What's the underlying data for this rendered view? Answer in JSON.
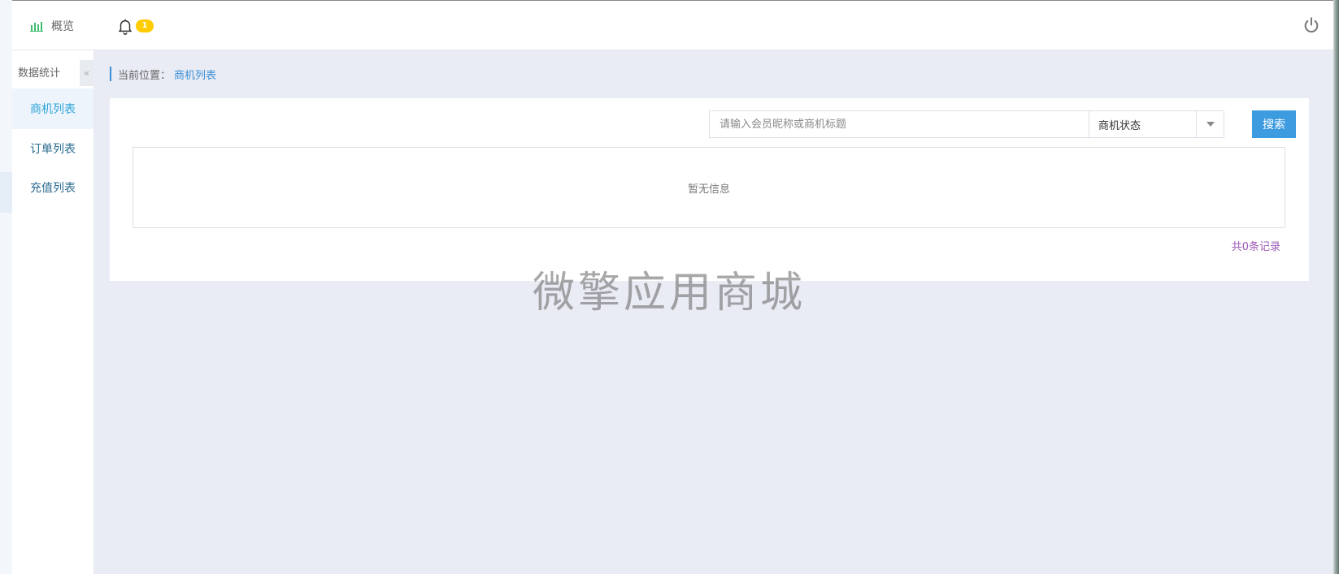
{
  "header": {
    "brand_label": "概览",
    "notification_count": "1"
  },
  "sidebar": {
    "title": "数据统计",
    "collapse_glyph": "«",
    "items": [
      {
        "label": "商机列表",
        "active": true
      },
      {
        "label": "订单列表",
        "active": false
      },
      {
        "label": "充值列表",
        "active": false
      }
    ]
  },
  "breadcrumb": {
    "prefix": "当前位置：",
    "current": "商机列表"
  },
  "filters": {
    "search_placeholder": "请输入会员昵称或商机标题",
    "search_value": "",
    "status_selected": "商机状态",
    "search_button": "搜索"
  },
  "table": {
    "empty_text": "暂无信息",
    "record_count": "共0条记录"
  },
  "watermark": "微擎应用商城",
  "colors": {
    "accent": "#3d9be0",
    "badge": "#ffcc00",
    "sidebar_active": "#2fa4d8",
    "count_text": "#9b59b6"
  },
  "icons": [
    "bar-chart-icon",
    "bell-icon",
    "power-icon",
    "chevron-left-icon",
    "chevron-down-icon"
  ]
}
